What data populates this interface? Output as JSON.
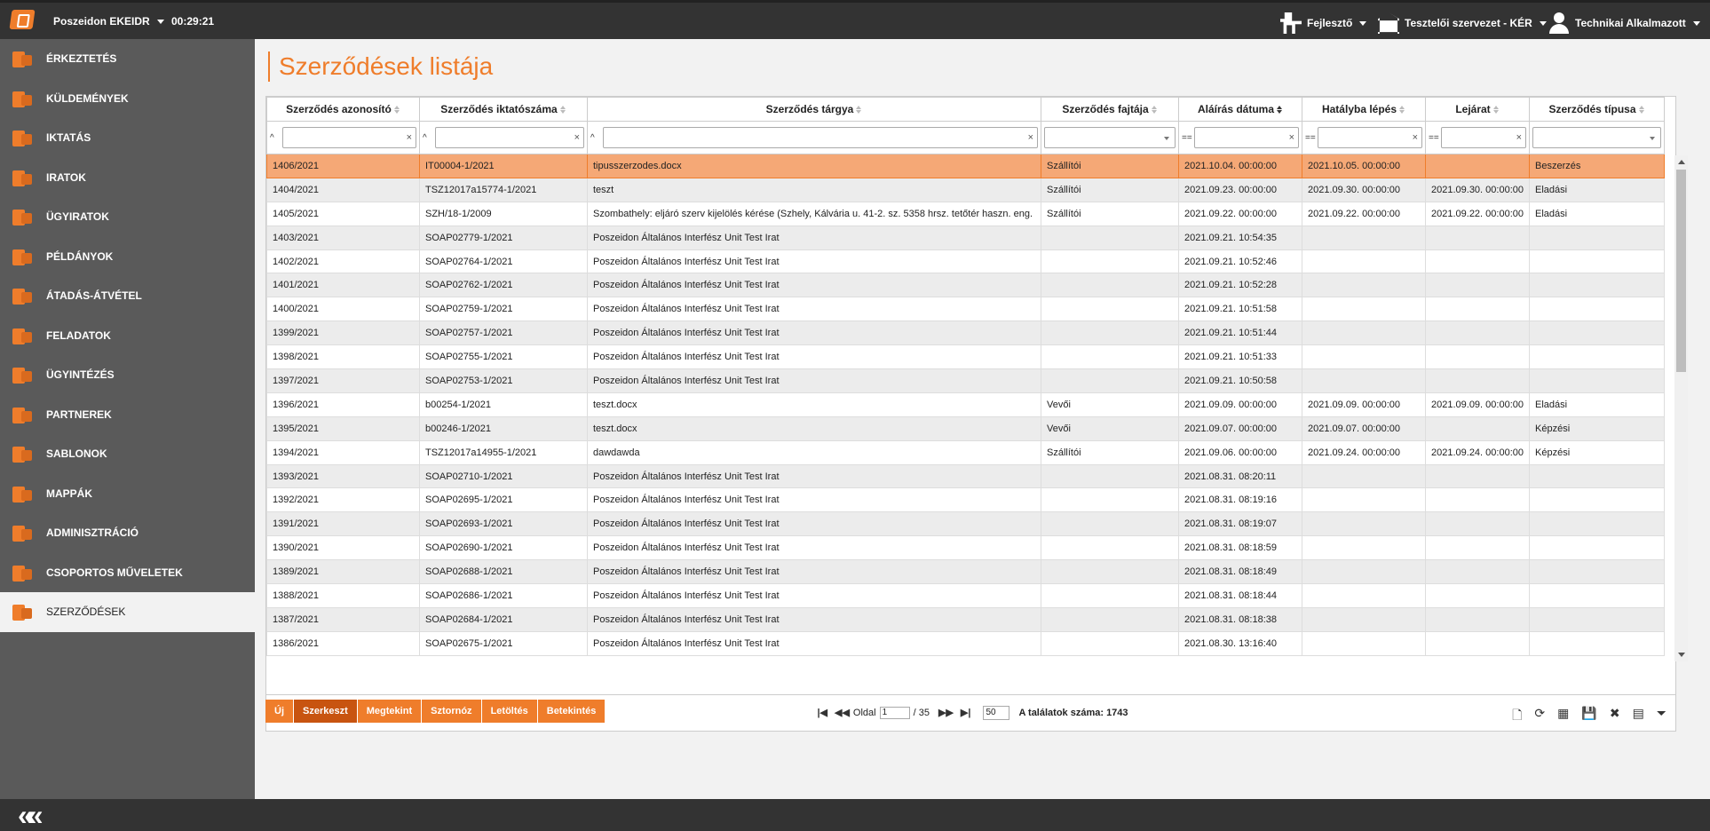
{
  "app": {
    "name": "Poszeidon EKEIDR",
    "timer": "00:29:21"
  },
  "topnav": [
    {
      "label": "Fejlesztő",
      "icon": "developer-icon"
    },
    {
      "label": "Tesztelői szervezet - KÉR",
      "icon": "institution-icon"
    },
    {
      "label": "Technikai Alkalmazott",
      "icon": "user-icon"
    }
  ],
  "sidebar": {
    "items": [
      {
        "label": "Érkeztetés"
      },
      {
        "label": "Küldemények"
      },
      {
        "label": "Iktatás"
      },
      {
        "label": "Iratok"
      },
      {
        "label": "Ügyiratok"
      },
      {
        "label": "Példányok"
      },
      {
        "label": "Átadás-átvétel"
      },
      {
        "label": "Feladatok"
      },
      {
        "label": "Ügyintézés"
      },
      {
        "label": "Partnerek"
      },
      {
        "label": "Sablonok"
      },
      {
        "label": "Mappák"
      },
      {
        "label": "Adminisztráció"
      },
      {
        "label": "Csoportos műveletek"
      },
      {
        "label": "Szerződések"
      }
    ]
  },
  "page": {
    "title": "Szerződések listája"
  },
  "table": {
    "columns": [
      {
        "label": "Szerződés azonosító",
        "filter_op": "^",
        "filter": "text"
      },
      {
        "label": "Szerződés iktatószáma",
        "filter_op": "^",
        "filter": "text"
      },
      {
        "label": "Szerződés tárgya",
        "filter_op": "^",
        "filter": "text"
      },
      {
        "label": "Szerződés fajtája",
        "filter_op": "",
        "filter": "select"
      },
      {
        "label": "Aláírás dátuma",
        "filter_op": "==",
        "filter": "text"
      },
      {
        "label": "Hatályba lépés",
        "filter_op": "==",
        "filter": "text"
      },
      {
        "label": "Lejárat",
        "filter_op": "==",
        "filter": "text"
      },
      {
        "label": "Szerződés típusa",
        "filter_op": "",
        "filter": "select"
      }
    ],
    "rows": [
      [
        "1406/2021",
        "IT00004-1/2021",
        "tipusszerzodes.docx",
        "Szállítói",
        "2021.10.04. 00:00:00",
        "2021.10.05. 00:00:00",
        "",
        "Beszerzés"
      ],
      [
        "1404/2021",
        "TSZ12017a15774-1/2021",
        "teszt",
        "Szállítói",
        "2021.09.23. 00:00:00",
        "2021.09.30. 00:00:00",
        "2021.09.30. 00:00:00",
        "Eladási"
      ],
      [
        "1405/2021",
        "SZH/18-1/2009",
        "Szombathely: eljáró szerv kijelölés kérése (Szhely, Kálvária u. 41-2. sz. 5358 hrsz. tetőtér haszn. eng.",
        "Szállítói",
        "2021.09.22. 00:00:00",
        "2021.09.22. 00:00:00",
        "2021.09.22. 00:00:00",
        "Eladási"
      ],
      [
        "1403/2021",
        "SOAP02779-1/2021",
        "Poszeidon Általános Interfész Unit Test Irat",
        "",
        "2021.09.21. 10:54:35",
        "",
        "",
        ""
      ],
      [
        "1402/2021",
        "SOAP02764-1/2021",
        "Poszeidon Általános Interfész Unit Test Irat",
        "",
        "2021.09.21. 10:52:46",
        "",
        "",
        ""
      ],
      [
        "1401/2021",
        "SOAP02762-1/2021",
        "Poszeidon Általános Interfész Unit Test Irat",
        "",
        "2021.09.21. 10:52:28",
        "",
        "",
        ""
      ],
      [
        "1400/2021",
        "SOAP02759-1/2021",
        "Poszeidon Általános Interfész Unit Test Irat",
        "",
        "2021.09.21. 10:51:58",
        "",
        "",
        ""
      ],
      [
        "1399/2021",
        "SOAP02757-1/2021",
        "Poszeidon Általános Interfész Unit Test Irat",
        "",
        "2021.09.21. 10:51:44",
        "",
        "",
        ""
      ],
      [
        "1398/2021",
        "SOAP02755-1/2021",
        "Poszeidon Általános Interfész Unit Test Irat",
        "",
        "2021.09.21. 10:51:33",
        "",
        "",
        ""
      ],
      [
        "1397/2021",
        "SOAP02753-1/2021",
        "Poszeidon Általános Interfész Unit Test Irat",
        "",
        "2021.09.21. 10:50:58",
        "",
        "",
        ""
      ],
      [
        "1396/2021",
        "b00254-1/2021",
        "teszt.docx",
        "Vevői",
        "2021.09.09. 00:00:00",
        "2021.09.09. 00:00:00",
        "2021.09.09. 00:00:00",
        "Eladási"
      ],
      [
        "1395/2021",
        "b00246-1/2021",
        "teszt.docx",
        "Vevői",
        "2021.09.07. 00:00:00",
        "2021.09.07. 00:00:00",
        "",
        "Képzési"
      ],
      [
        "1394/2021",
        "TSZ12017a14955-1/2021",
        "dawdawda",
        "Szállítói",
        "2021.09.06. 00:00:00",
        "2021.09.24. 00:00:00",
        "2021.09.24. 00:00:00",
        "Képzési"
      ],
      [
        "1393/2021",
        "SOAP02710-1/2021",
        "Poszeidon Általános Interfész Unit Test Irat",
        "",
        "2021.08.31. 08:20:11",
        "",
        "",
        ""
      ],
      [
        "1392/2021",
        "SOAP02695-1/2021",
        "Poszeidon Általános Interfész Unit Test Irat",
        "",
        "2021.08.31. 08:19:16",
        "",
        "",
        ""
      ],
      [
        "1391/2021",
        "SOAP02693-1/2021",
        "Poszeidon Általános Interfész Unit Test Irat",
        "",
        "2021.08.31. 08:19:07",
        "",
        "",
        ""
      ],
      [
        "1390/2021",
        "SOAP02690-1/2021",
        "Poszeidon Általános Interfész Unit Test Irat",
        "",
        "2021.08.31. 08:18:59",
        "",
        "",
        ""
      ],
      [
        "1389/2021",
        "SOAP02688-1/2021",
        "Poszeidon Általános Interfész Unit Test Irat",
        "",
        "2021.08.31. 08:18:49",
        "",
        "",
        ""
      ],
      [
        "1388/2021",
        "SOAP02686-1/2021",
        "Poszeidon Általános Interfész Unit Test Irat",
        "",
        "2021.08.31. 08:18:44",
        "",
        "",
        ""
      ],
      [
        "1387/2021",
        "SOAP02684-1/2021",
        "Poszeidon Általános Interfész Unit Test Irat",
        "",
        "2021.08.31. 08:18:38",
        "",
        "",
        ""
      ],
      [
        "1386/2021",
        "SOAP02675-1/2021",
        "Poszeidon Általános Interfész Unit Test Irat",
        "",
        "2021.08.30. 13:16:40",
        "",
        "",
        ""
      ]
    ]
  },
  "pager": {
    "page_label": "Oldal",
    "page": "1",
    "total_pages": "/ 35",
    "page_size": "50",
    "count_label": "A találatok száma: 1743"
  },
  "actions": [
    {
      "label": "Új"
    },
    {
      "label": "Szerkeszt"
    },
    {
      "label": "Megtekint"
    },
    {
      "label": "Sztornóz"
    },
    {
      "label": "Letöltés"
    },
    {
      "label": "Betekintés"
    }
  ],
  "colors": {
    "accent": "#ef7d2b",
    "selected_row": "#f5a876",
    "sidebar": "#5a5a5a",
    "topbar": "#333333"
  }
}
